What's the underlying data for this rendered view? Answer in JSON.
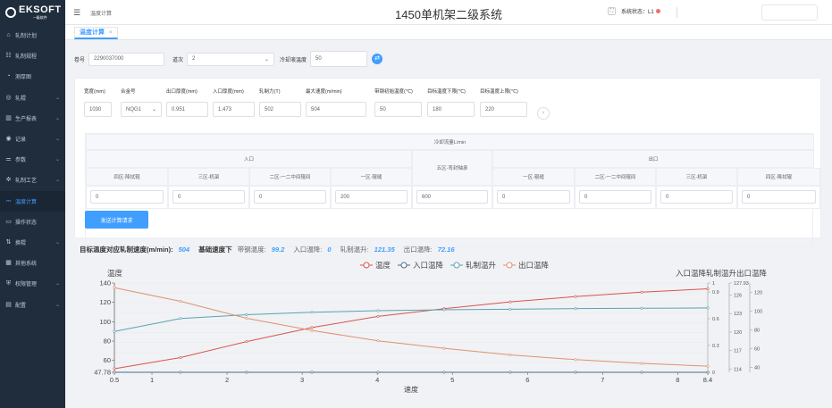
{
  "logo": {
    "brand": "EKSOFT",
    "sub": "一级软件"
  },
  "sidebar": {
    "items": [
      {
        "label": "轧制计划",
        "icon": "home-icon",
        "chev": false
      },
      {
        "label": "轧制规程",
        "icon": "grid-icon",
        "chev": false
      },
      {
        "label": "测厚图",
        "icon": "gauge-icon",
        "chev": false
      },
      {
        "label": "轧辊",
        "icon": "roll-icon",
        "chev": true
      },
      {
        "label": "生产报表",
        "icon": "bar-chart-icon",
        "chev": true
      },
      {
        "label": "记录",
        "icon": "record-icon",
        "chev": true
      },
      {
        "label": "参数",
        "icon": "sliders-icon",
        "chev": true
      },
      {
        "label": "轧制工艺",
        "icon": "gear-icon",
        "chev": true
      },
      {
        "label": "温度计算",
        "icon": "temperature-icon",
        "chev": false,
        "active": true
      },
      {
        "label": "操作状态",
        "icon": "monitor-icon",
        "chev": false
      },
      {
        "label": "换辊",
        "icon": "swap-icon",
        "chev": true
      },
      {
        "label": "其他系统",
        "icon": "apps-icon",
        "chev": false
      },
      {
        "label": "权限管理",
        "icon": "shield-icon",
        "chev": true
      },
      {
        "label": "配置",
        "icon": "config-icon",
        "chev": true
      }
    ]
  },
  "header": {
    "breadcrumb": "温度计算",
    "title": "1450单机架二级系统",
    "status_label": "系统状态：L1",
    "status_color": "#f56c6c"
  },
  "tabs": [
    {
      "label": "温度计算"
    }
  ],
  "form": {
    "coil_label": "卷号",
    "coil_value": "2290037000",
    "pass_label": "道次",
    "pass_value": "2",
    "coolant_label": "冷却液温度",
    "coolant_value": "50"
  },
  "params": [
    {
      "label": "宽度(mm)",
      "value": "1030"
    },
    {
      "label": "合金号",
      "value": "NQG1"
    },
    {
      "label": "出口厚度(mm)",
      "value": "0.951"
    },
    {
      "label": "入口厚度(mm)",
      "value": "1.473"
    },
    {
      "label": "轧制力(T)",
      "value": "502"
    },
    {
      "label": "最大速度(m/min)",
      "value": "504"
    },
    {
      "label": "带钢初始温度(℃)",
      "value": "50"
    },
    {
      "label": "目标温度下限(℃)",
      "value": "180"
    },
    {
      "label": "目标温度上限(℃)",
      "value": "220"
    }
  ],
  "cooling": {
    "title": "冷却流量L/min",
    "entry": "入口",
    "exit": "出口",
    "middle": "五区-弯封轴承",
    "middle_value": "600",
    "entry_cols": [
      {
        "label": "四区-降拭辊",
        "value": "0"
      },
      {
        "label": "三区-机架",
        "value": "0"
      },
      {
        "label": "二区-一二中间辊间",
        "value": "0"
      },
      {
        "label": "一区-辊缝",
        "value": "200"
      }
    ],
    "exit_cols": [
      {
        "label": "一区-辊缝",
        "value": "0"
      },
      {
        "label": "二区-一二中间辊间",
        "value": "0"
      },
      {
        "label": "三区-机架",
        "value": "0"
      },
      {
        "label": "四区-降拭辊",
        "value": "0"
      }
    ],
    "send_label": "发送计算请求"
  },
  "summary": {
    "k1": "目标温度对应轧制速度(m/min):",
    "v1": "504",
    "k2": "基础速度下",
    "k3": "带钢温度:",
    "v3": "99.2",
    "k4": "入口温降:",
    "v4": "0",
    "k5": "轧制温升:",
    "v5": "121.35",
    "k6": "出口温降:",
    "v6": "72.16"
  },
  "chart_data": {
    "type": "line",
    "xlabel": "速度",
    "ylabel": "温度",
    "right_label": "入口温降轧制温升出口温降",
    "x": [
      0.5,
      1.38,
      2.26,
      3.13,
      4.01,
      4.89,
      5.77,
      6.64,
      7.52,
      8.4
    ],
    "x_ticks": [
      "0.5",
      "1",
      "2",
      "3",
      "4",
      "5",
      "6",
      "7",
      "8",
      "8.4"
    ],
    "x_tick_values": [
      0.5,
      1,
      2,
      3,
      4,
      5,
      6,
      7,
      8,
      8.4
    ],
    "y_ticks": [
      "47.78",
      "60",
      "80",
      "100",
      "120",
      "140"
    ],
    "y_tick_values": [
      47.78,
      60,
      80,
      100,
      120,
      140
    ],
    "ylim": [
      47.78,
      140
    ],
    "right_axes": [
      {
        "ticks": [
          "0",
          "0.3",
          "0.6",
          "0.9",
          "1"
        ],
        "values": [
          0,
          0.3,
          0.6,
          0.9,
          1
        ],
        "lim": [
          0,
          1
        ]
      },
      {
        "ticks": [
          "114",
          "117",
          "120",
          "123",
          "126",
          "127.93"
        ],
        "values": [
          114,
          117,
          120,
          123,
          126,
          127.93
        ],
        "lim": [
          113.5,
          127.93
        ]
      },
      {
        "ticks": [
          "40",
          "60",
          "80",
          "100",
          "120"
        ],
        "values": [
          40,
          60,
          80,
          100,
          120
        ],
        "lim": [
          35,
          130
        ]
      }
    ],
    "series": [
      {
        "name": "温度",
        "color": "#d9534f",
        "axis": "left",
        "values": [
          51.5,
          63,
          79.5,
          94,
          105.5,
          113.5,
          120.5,
          126,
          130.5,
          134
        ]
      },
      {
        "name": "入口温降",
        "color": "#4a6a8a",
        "axis": "r1",
        "values": [
          0,
          0,
          0,
          0,
          0,
          0,
          0,
          0,
          0,
          0
        ]
      },
      {
        "name": "轧制温升",
        "color": "#5ba3b0",
        "axis": "r2",
        "values": [
          120.1,
          122.2,
          122.8,
          123.2,
          123.45,
          123.6,
          123.7,
          123.8,
          123.85,
          123.9
        ]
      },
      {
        "name": "出口温降",
        "color": "#e0916e",
        "axis": "r3",
        "values": [
          125,
          110.5,
          92.5,
          79.5,
          68.5,
          60.5,
          53.5,
          48.5,
          44.5,
          41.5
        ]
      }
    ],
    "legend": "top-center",
    "grid": true
  }
}
